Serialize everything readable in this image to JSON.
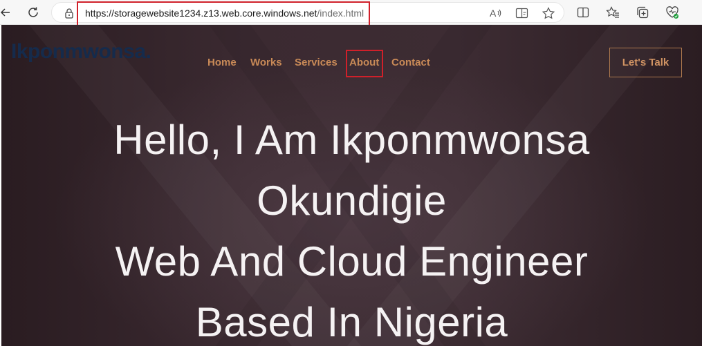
{
  "browser": {
    "url_main": "https://storagewebsite1234.z13.web.core.windows.net",
    "url_path": "/index.html",
    "icons": [
      "back-icon",
      "refresh-icon",
      "lock-icon",
      "read-aloud-icon",
      "immersive-reader-icon",
      "favorite-star-icon",
      "split-screen-icon",
      "favorites-icon",
      "collections-icon",
      "browser-essentials-icon"
    ]
  },
  "site": {
    "brand": "Ikponmwonsa.",
    "nav": [
      {
        "label": "Home"
      },
      {
        "label": "Works"
      },
      {
        "label": "Services"
      },
      {
        "label": "About"
      },
      {
        "label": "Contact"
      }
    ],
    "cta_label": "Let's Talk",
    "hero_lines": [
      "Hello, I Am Ikponmwonsa",
      "Okundigie",
      "Web And Cloud Engineer",
      "Based In Nigeria"
    ],
    "colors": {
      "nav": "#c98a57",
      "brand": "#152b4c",
      "highlight": "#d0202a"
    }
  }
}
